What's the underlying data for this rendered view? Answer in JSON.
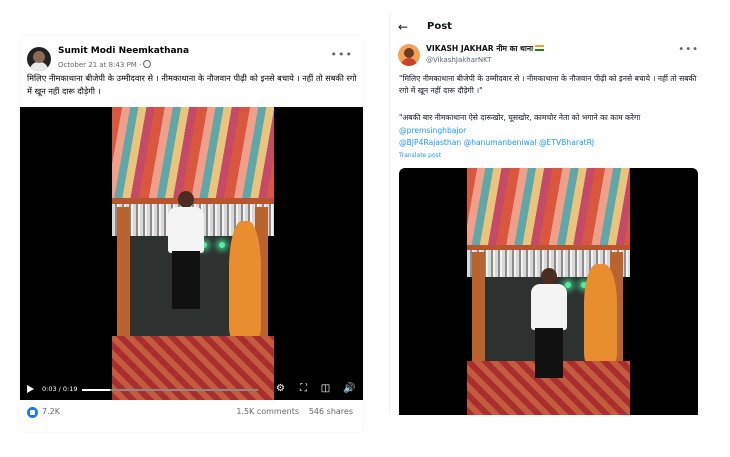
{
  "facebook": {
    "author": "Sumit Modi Neemkathana",
    "date": "October 21 at 8:43 PM",
    "post_text": "मिलिए नीमकाथाना बीजेपी के उम्मीदवार से । नीमकाथाना के नौजवान पीढ़ी को इनसे बचाये । नहीं तो सबकी रगो में खून नहीं दारू दौड़ेगी ।",
    "video": {
      "time": "0:03 / 0:19",
      "progress": 0.16
    },
    "stats": {
      "likes": "7.2K",
      "comments": "1.5K comments",
      "shares": "546 shares"
    }
  },
  "twitter": {
    "header": "Post",
    "display_name": "VIKASH JAKHAR नीम का थाना",
    "handle": "@VikashJakharNKT",
    "quote_text": "\"मिलिए नीमकाथाना बीजेपी के उम्मीदवार से । नीमकाथाना के नौजवान पीढ़ी को इनसे बचाये । नहीं तो सबकी रगो में खून नहीं दारू दौड़ेगी ।\"",
    "comment_text": "\"अबकी बार नीमकाथाना ऐसे दारूखोर, घूसखोर, कामचोर नेता को भगाने का काम करेगा",
    "mentions": [
      "@premsinghbajor",
      "@BJP4Rajasthan @hanumanbeniwal @ETVBharatRJ"
    ],
    "translate": "Translate post"
  }
}
